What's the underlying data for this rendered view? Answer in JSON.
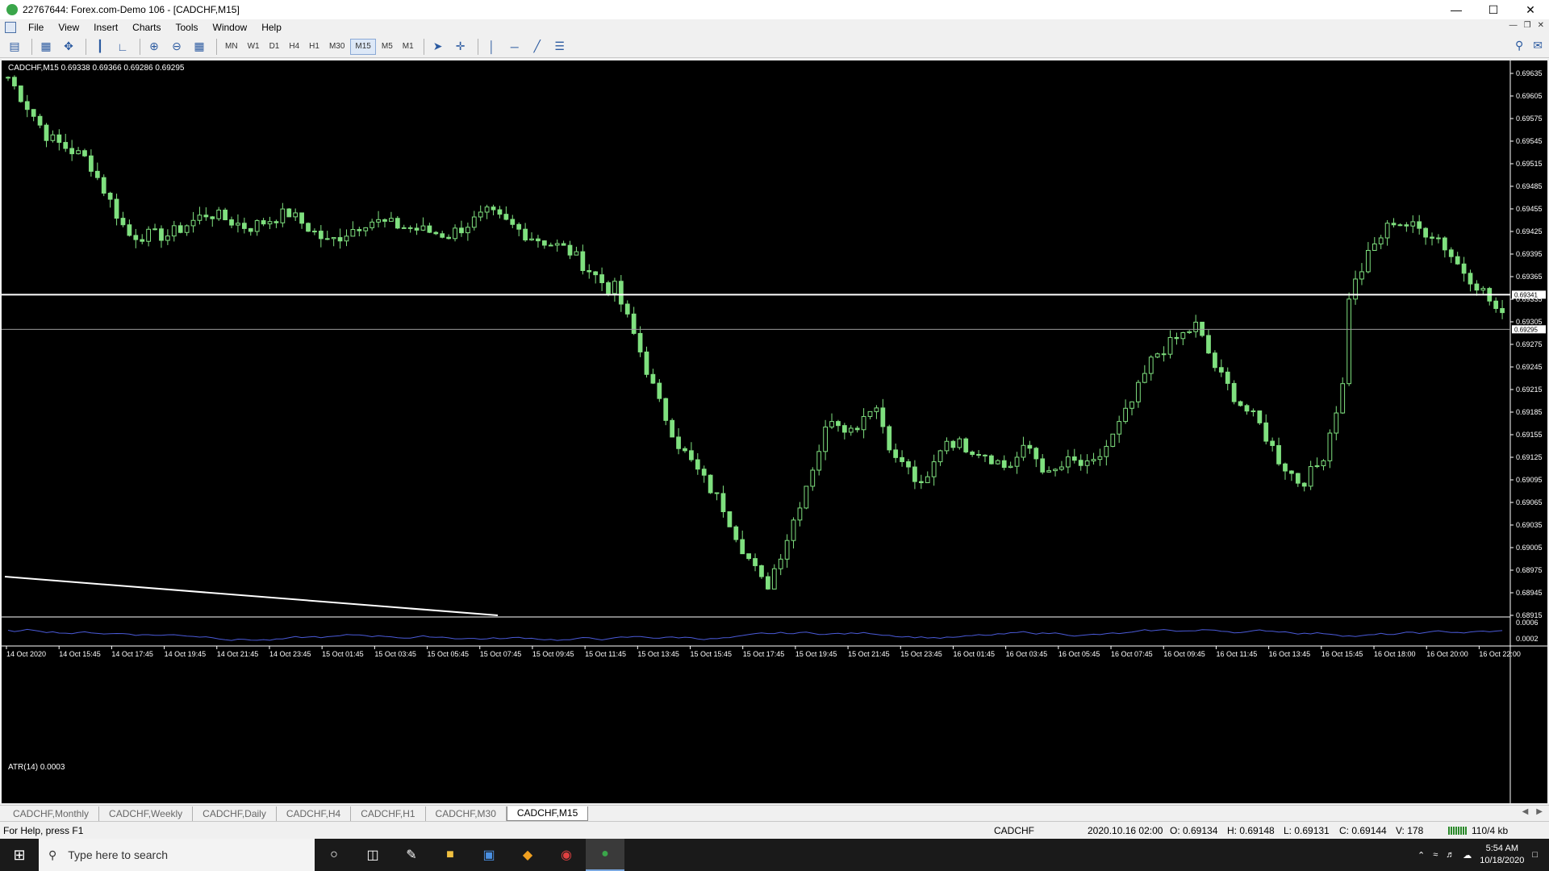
{
  "window": {
    "title": "22767644: Forex.com-Demo 106 - [CADCHF,M15]",
    "controls": [
      "—",
      "☐",
      "✕"
    ]
  },
  "menu": [
    "File",
    "View",
    "Insert",
    "Charts",
    "Tools",
    "Window",
    "Help"
  ],
  "toolbar": {
    "timeframes": [
      "MN",
      "W1",
      "D1",
      "H4",
      "H1",
      "M30",
      "M15",
      "M5",
      "M1"
    ],
    "active_timeframe": "M15",
    "icons": [
      "new-chart-icon",
      "profiles-icon",
      "market-watch-icon",
      "navigator-icon",
      "bar-chart-icon",
      "line-chart-icon",
      "zoom-in-icon",
      "zoom-out-icon",
      "tile-windows-icon",
      "cursor-icon",
      "crosshair-icon",
      "vertical-line-icon",
      "horizontal-line-icon",
      "trendline-icon",
      "fibonacci-icon",
      "search-icon",
      "chat-icon"
    ]
  },
  "chart": {
    "info": "CADCHF,M15  0.69338 0.69366 0.69286 0.69295",
    "atr_label": "ATR(14) 0.0003",
    "price_labels": [
      "0.69635",
      "0.69605",
      "0.69575",
      "0.69545",
      "0.69515",
      "0.69485",
      "0.69455",
      "0.69425",
      "0.69395",
      "0.69365",
      "0.69335",
      "0.69305",
      "0.69275",
      "0.69245",
      "0.69215",
      "0.69185",
      "0.69155",
      "0.69125",
      "0.69095",
      "0.69065",
      "0.69035",
      "0.69005",
      "0.68975",
      "0.68945",
      "0.68915"
    ],
    "current_price": "0.69295",
    "hline_price": "0.69341",
    "atr_scale": [
      "0.0006",
      "0.0002"
    ],
    "time_labels": [
      "14 Oct 2020",
      "14 Oct 15:45",
      "14 Oct 17:45",
      "14 Oct 19:45",
      "14 Oct 21:45",
      "14 Oct 23:45",
      "15 Oct 01:45",
      "15 Oct 03:45",
      "15 Oct 05:45",
      "15 Oct 07:45",
      "15 Oct 09:45",
      "15 Oct 11:45",
      "15 Oct 13:45",
      "15 Oct 15:45",
      "15 Oct 17:45",
      "15 Oct 19:45",
      "15 Oct 21:45",
      "15 Oct 23:45",
      "16 Oct 01:45",
      "16 Oct 03:45",
      "16 Oct 05:45",
      "16 Oct 07:45",
      "16 Oct 09:45",
      "16 Oct 11:45",
      "16 Oct 13:45",
      "16 Oct 15:45",
      "16 Oct 18:00",
      "16 Oct 20:00",
      "16 Oct 22:00"
    ],
    "bull_color": "#000000",
    "bear_color": "#7fe07f",
    "wick_color": "#7fe07f",
    "atr_color": "#4a5ad8"
  },
  "chart_data": {
    "type": "candlestick",
    "symbol": "CADCHF",
    "timeframe": "M15",
    "ylim": [
      0.68915,
      0.6965
    ],
    "segments": [
      {
        "n": 95,
        "levels": [
          0.6963,
          0.6955,
          0.6952,
          0.6942,
          0.6942,
          0.6945,
          0.6943,
          0.6945,
          0.6941,
          0.6944,
          0.6943,
          0.6942,
          0.6945,
          0.6942,
          0.694,
          0.6935
        ]
      },
      {
        "n": 45,
        "levels": [
          0.6935,
          0.6928,
          0.692,
          0.6914,
          0.691,
          0.6906,
          0.69,
          0.6895,
          0.6902,
          0.691,
          0.6918,
          0.6916,
          0.692,
          0.6912
        ]
      },
      {
        "n": 70,
        "levels": [
          0.6912,
          0.6908,
          0.6915,
          0.6914,
          0.6913,
          0.6911,
          0.6914,
          0.691,
          0.6912,
          0.6911,
          0.6915,
          0.692,
          0.6926,
          0.6928,
          0.693,
          0.6924,
          0.692,
          0.6917,
          0.6912,
          0.6909,
          0.6912,
          0.6922
        ]
      },
      {
        "n": 25,
        "levels": [
          0.6934,
          0.694,
          0.6944,
          0.6943,
          0.6942,
          0.6938,
          0.6935,
          0.6931
        ]
      }
    ],
    "hline": 0.69341,
    "current": 0.69295
  },
  "tabs": [
    "CADCHF,Monthly",
    "CADCHF,Weekly",
    "CADCHF,Daily",
    "CADCHF,H4",
    "CADCHF,H1",
    "CADCHF,M30",
    "CADCHF,M15"
  ],
  "active_tab": "CADCHF,M15",
  "status": {
    "help": "For Help, press F1",
    "symbol": "CADCHF",
    "datetime": "2020.10.16 02:00",
    "open": "O: 0.69134",
    "high": "H: 0.69148",
    "low": "L: 0.69131",
    "close": "C: 0.69144",
    "volume": "V: 178",
    "traffic": "110/4 kb"
  },
  "taskbar": {
    "search_placeholder": "Type here to search",
    "time": "5:54 AM",
    "date": "10/18/2020"
  }
}
